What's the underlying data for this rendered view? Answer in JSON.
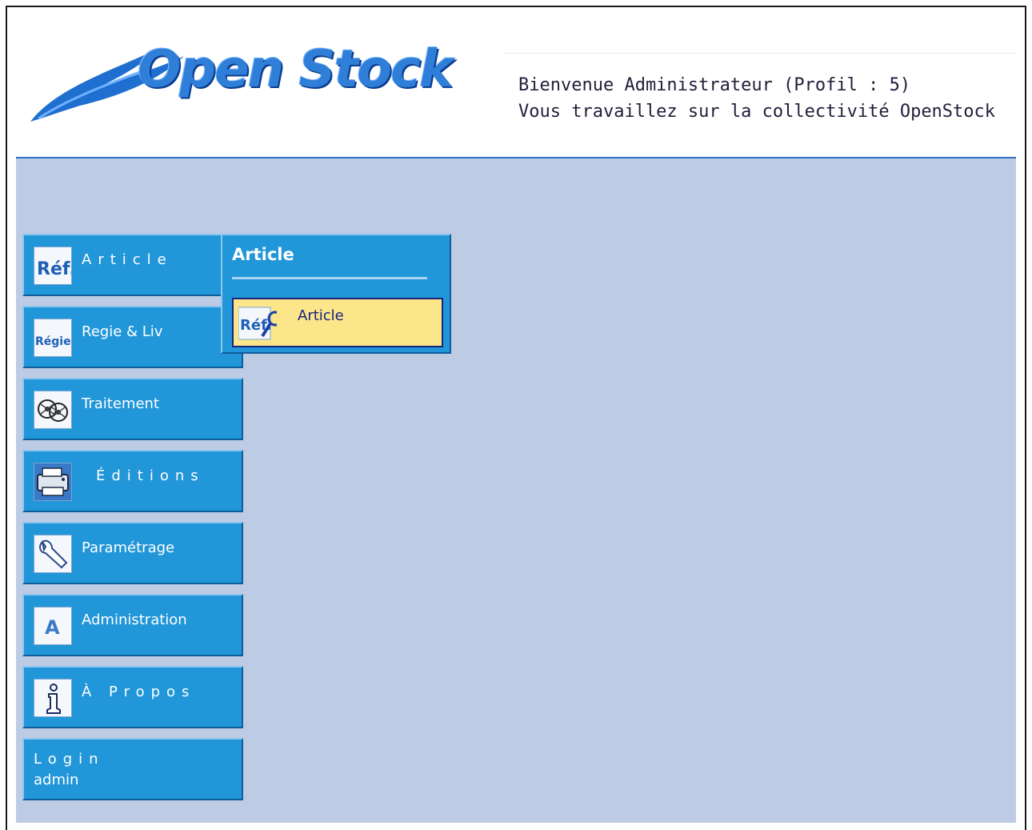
{
  "header": {
    "logo_text": "Open Stock",
    "welcome_line1": "Bienvenue Administrateur (Profil : 5)",
    "welcome_line2": "Vous travaillez sur la collectivité OpenStock"
  },
  "menu": {
    "items": [
      {
        "label": "Article",
        "icon": "ref-icon"
      },
      {
        "label": "Regie & Liv",
        "icon": "regie-icon"
      },
      {
        "label": "Traitement",
        "icon": "film-reels-icon"
      },
      {
        "label": "Éditions",
        "icon": "printer-icon"
      },
      {
        "label": "Paramétrage",
        "icon": "wrench-icon"
      },
      {
        "label": "Administration",
        "icon": "admin-a-icon"
      },
      {
        "label": "À Propos",
        "icon": "info-icon"
      }
    ],
    "login": {
      "label": "Login",
      "user": "admin"
    }
  },
  "submenu": {
    "title": "Article",
    "items": [
      {
        "label": "Article",
        "icon": "ref-search-icon"
      }
    ]
  },
  "colors": {
    "menu_blue": "#2196d8",
    "content_bg": "#bdcbe4",
    "highlight_yellow": "#fbe68a",
    "header_rule": "#2f6fc4"
  }
}
